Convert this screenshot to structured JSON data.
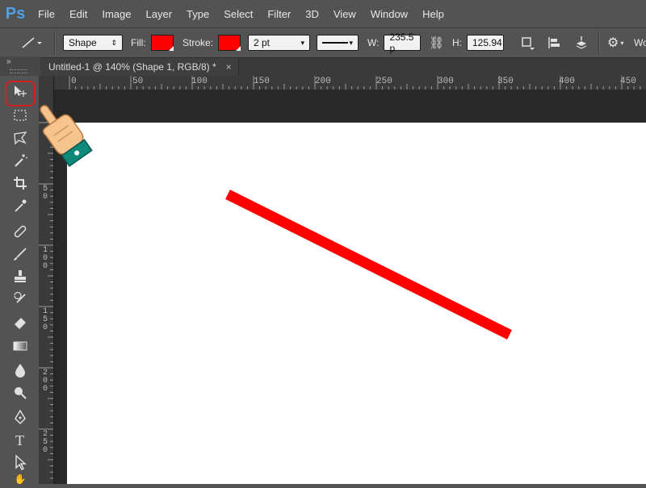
{
  "app": {
    "logo": "Ps"
  },
  "menu": [
    "File",
    "Edit",
    "Image",
    "Layer",
    "Type",
    "Select",
    "Filter",
    "3D",
    "View",
    "Window",
    "Help"
  ],
  "options": {
    "shape_mode": "Shape",
    "fill_label": "Fill:",
    "stroke_label": "Stroke:",
    "stroke_width": "2 pt",
    "w_label": "W:",
    "w_value": "235.5 p",
    "h_label": "H:",
    "h_value": "125.94",
    "trailing_text": "Wo",
    "fill_color": "#ff0000",
    "stroke_color": "#ff0000"
  },
  "document": {
    "tab_title": "Untitled-1 @ 140% (Shape 1, RGB/8) *",
    "close_glyph": "×"
  },
  "ruler": {
    "top_labels": [
      "0",
      "50",
      "100",
      "150",
      "200",
      "250",
      "300",
      "350",
      "400",
      "450"
    ],
    "left_labels": [
      "5",
      "0",
      "1",
      "0",
      "0",
      "1",
      "5",
      "0",
      "2",
      "0",
      "0",
      "2",
      "5",
      "0"
    ]
  },
  "tools": [
    {
      "name": "move-tool",
      "icon": "move-icon"
    },
    {
      "name": "marquee-tool",
      "icon": "marquee-icon"
    },
    {
      "name": "lasso-tool",
      "icon": "lasso-icon"
    },
    {
      "name": "magic-wand-tool",
      "icon": "magic-wand-icon"
    },
    {
      "name": "crop-tool",
      "icon": "crop-icon"
    },
    {
      "name": "eyedropper-tool",
      "icon": "eyedropper-icon"
    },
    {
      "name": "healing-brush-tool",
      "icon": "bandage-icon"
    },
    {
      "name": "brush-tool",
      "icon": "brush-icon"
    },
    {
      "name": "clone-stamp-tool",
      "icon": "stamp-icon"
    },
    {
      "name": "history-brush-tool",
      "icon": "history-brush-icon"
    },
    {
      "name": "eraser-tool",
      "icon": "eraser-icon"
    },
    {
      "name": "gradient-tool",
      "icon": "gradient-icon"
    },
    {
      "name": "blur-tool",
      "icon": "drop-icon"
    },
    {
      "name": "dodge-tool",
      "icon": "dodge-icon"
    },
    {
      "name": "pen-tool",
      "icon": "pen-icon"
    },
    {
      "name": "type-tool",
      "icon": "type-icon"
    },
    {
      "name": "path-selection-tool",
      "icon": "path-selection-icon"
    }
  ],
  "canvas": {
    "background": "#ffffff",
    "line_color": "#ff0000"
  },
  "colors": {
    "highlight": "#d32020",
    "ps_blue": "#4ea1e6",
    "ui_gray": "#535353"
  }
}
